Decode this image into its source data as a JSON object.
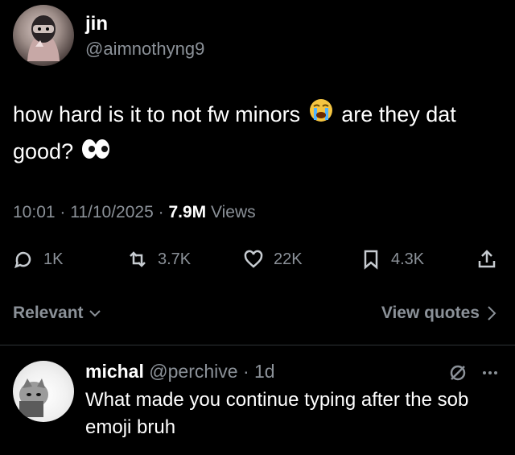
{
  "author": {
    "name": "jin",
    "handle": "@aimnothyng9"
  },
  "tweet": {
    "text_before_emoji": "how hard is it to not fw minors",
    "text_after_emoji": "are they dat good?",
    "time": "10:01",
    "date": "11/10/2025",
    "views_count": "7.9M",
    "views_label": "Views"
  },
  "actions": {
    "replies": "1K",
    "reposts": "3.7K",
    "likes": "22K",
    "bookmarks": "4.3K"
  },
  "filter": {
    "sort_label": "Relevant",
    "quotes_label": "View quotes"
  },
  "reply": {
    "name": "michal",
    "handle": "@perchive",
    "time": "1d",
    "text": "What made you continue typing after the sob emoji bruh"
  },
  "icons": [
    "sob-emoji",
    "eyes-emoji",
    "reply-icon",
    "repost-icon",
    "like-icon",
    "bookmark-icon",
    "share-icon",
    "chevron-down-icon",
    "chevron-right-icon",
    "grok-icon",
    "more-icon"
  ],
  "colors": {
    "background": "#000000",
    "secondary_text": "#8b9198",
    "primary_text": "#ffffff"
  }
}
